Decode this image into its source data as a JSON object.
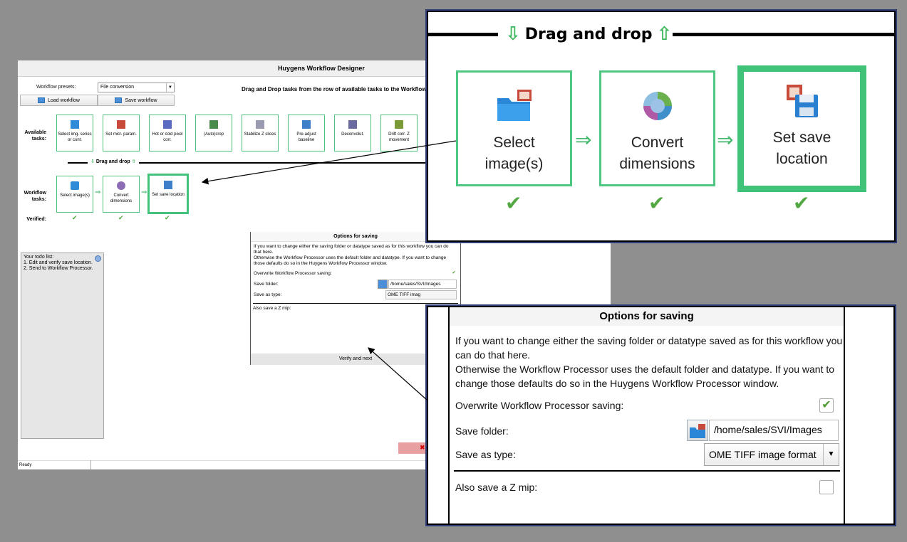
{
  "window": {
    "title": "Huygens Workflow Designer"
  },
  "presets": {
    "label": "Workflow presets:",
    "value": "File conversion"
  },
  "buttons": {
    "load": "Load workflow",
    "save": "Save workflow",
    "verify": "Verify and next"
  },
  "dnd_instruction": "Drag and Drop tasks from the row of available tasks to the Workflow",
  "labels": {
    "available": "Available tasks:",
    "workflow": "Workflow tasks:",
    "verified": "Verified:"
  },
  "available_tasks": [
    "Select img. series or cont.",
    "Set micr. param.",
    "Hot or cold pixel corr.",
    "(Auto)crop",
    "Stabilize Z slices",
    "Pre-adjust baseline",
    "Deconvolut.",
    "Drift corr. Z movement"
  ],
  "workflow_tasks": [
    "Select image(s)",
    "Convert dimensions",
    "Set save location"
  ],
  "drag_drop": "Drag and drop",
  "todo": {
    "title": "Your todo list:",
    "items": [
      "1. Edit and verify save location.",
      "2. Send to Workflow Processor."
    ]
  },
  "options": {
    "title": "Options for saving",
    "description": "If you want to change either the saving folder or datatype saved as for this workflow you can do that here.",
    "description2": "Otherwise the Workflow Processor uses the default folder and datatype. If you want to change those defaults do so in the Huygens Workflow Processor window.",
    "overwrite_label": "Overwrite Workflow Processor saving:",
    "save_folder_label": "Save folder:",
    "save_folder_value": "/home/sales/SVI/Images",
    "save_type_label": "Save as type:",
    "save_type_value": "OME TIFF image format",
    "save_type_short": "OME TIFF imag",
    "zmip_label": "Also save a Z mip:"
  },
  "status": "Ready",
  "zoom_tiles": [
    "Select image(s)",
    "Convert dimensions",
    "Set save location"
  ]
}
